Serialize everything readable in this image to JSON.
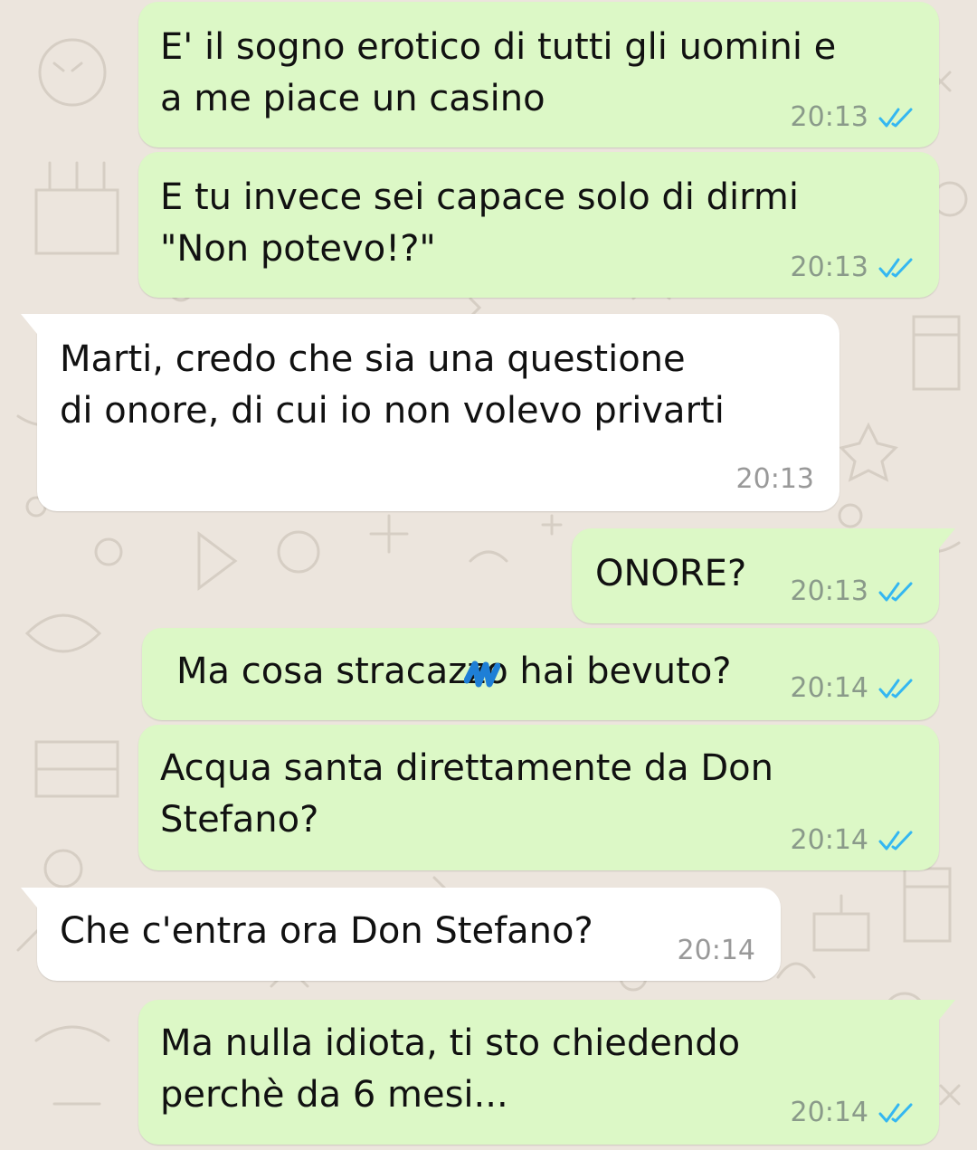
{
  "colors": {
    "outgoing_bubble": "#dcf8c6",
    "incoming_bubble": "#ffffff",
    "read_ticks": "#34b7f1",
    "wallpaper": "#ece5dd"
  },
  "icons": {
    "read_receipt": "double-check-icon"
  },
  "messages": [
    {
      "direction": "out",
      "text": "E' il sogno erotico di tutti gli uomini e\na me piace un casino",
      "time": "20:13",
      "status": "read"
    },
    {
      "direction": "out",
      "text": "E tu invece sei capace solo di dirmi\n\"Non potevo!?\"",
      "time": "20:13",
      "status": "read"
    },
    {
      "direction": "in",
      "text": "Marti, credo che sia una questione\ndi onore, di cui io non volevo privarti",
      "time": "20:13"
    },
    {
      "direction": "out",
      "text": "ONORE?",
      "time": "20:13",
      "status": "read"
    },
    {
      "direction": "out",
      "text": "Ma cosa stracazzo hai bevuto?",
      "time": "20:14",
      "status": "read",
      "redacted": "scribble over part of a word"
    },
    {
      "direction": "out",
      "text": "Acqua santa direttamente da Don\nStefano?",
      "time": "20:14",
      "status": "read"
    },
    {
      "direction": "in",
      "text": "Che c'entra ora Don Stefano?",
      "time": "20:14"
    },
    {
      "direction": "out",
      "text": "Ma nulla idiota, ti sto chiedendo\nperchè da 6 mesi...",
      "time": "20:14",
      "status": "read"
    }
  ]
}
